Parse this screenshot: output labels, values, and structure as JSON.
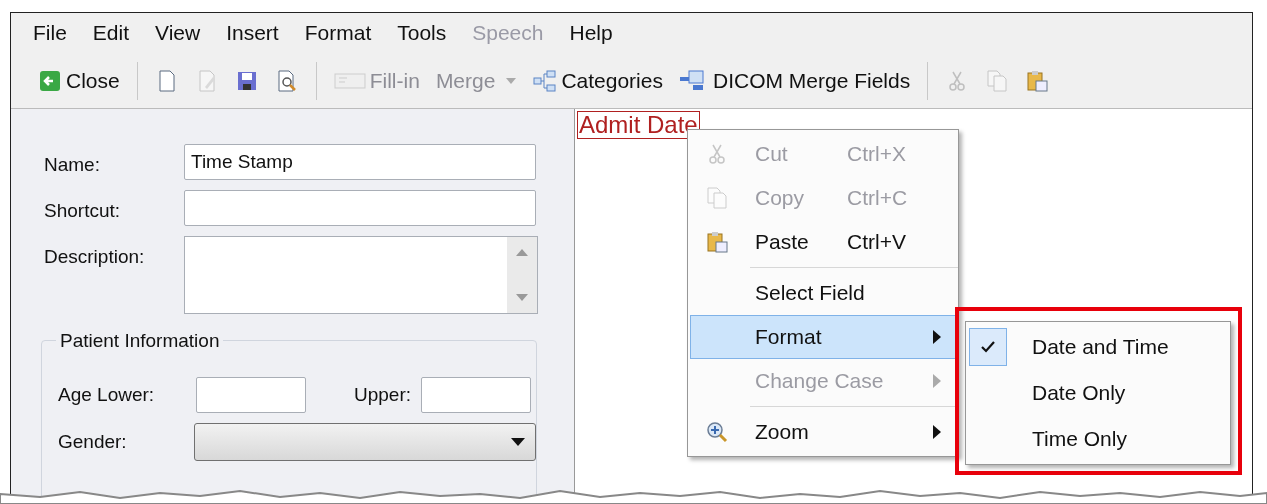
{
  "menu_bar": [
    {
      "label": "File",
      "disabled": false
    },
    {
      "label": "Edit",
      "disabled": false
    },
    {
      "label": "View",
      "disabled": false
    },
    {
      "label": "Insert",
      "disabled": false
    },
    {
      "label": "Format",
      "disabled": false
    },
    {
      "label": "Tools",
      "disabled": false
    },
    {
      "label": "Speech",
      "disabled": true
    },
    {
      "label": "Help",
      "disabled": false
    }
  ],
  "toolbar": [
    {
      "kind": "button",
      "label": "Close",
      "disabled": false
    },
    {
      "kind": "separator"
    },
    {
      "kind": "button",
      "disabled": false
    },
    {
      "kind": "button",
      "disabled": true
    },
    {
      "kind": "button",
      "disabled": false
    },
    {
      "kind": "button",
      "disabled": false
    },
    {
      "kind": "separator"
    },
    {
      "kind": "button",
      "label": "Fill-in",
      "disabled": true
    },
    {
      "kind": "dropdown",
      "label": "Merge",
      "disabled": true
    },
    {
      "kind": "button",
      "label": "Categories",
      "disabled": false
    },
    {
      "kind": "button",
      "label": "DICOM Merge Fields",
      "disabled": false
    },
    {
      "kind": "separator"
    },
    {
      "kind": "button",
      "disabled": true
    },
    {
      "kind": "button",
      "disabled": true
    },
    {
      "kind": "button",
      "disabled": false
    }
  ],
  "form": {
    "name": {
      "label": "Name:",
      "value": "Time Stamp"
    },
    "shortcut": {
      "label": "Shortcut:"
    },
    "description": {
      "label": "Description:"
    },
    "patient_information": {
      "title": "Patient Information",
      "age_lower": {
        "label": "Age Lower:"
      },
      "upper": {
        "label": "Upper:"
      },
      "gender": {
        "label": "Gender:"
      }
    }
  },
  "editor": {
    "field_text": "Admit Date"
  },
  "context_menu": [
    {
      "kind": "command",
      "label": "Cut",
      "shortcut": "Ctrl+X",
      "disabled": true,
      "selected": false,
      "divider_above": false
    },
    {
      "kind": "command",
      "label": "Copy",
      "shortcut": "Ctrl+C",
      "disabled": true,
      "selected": false,
      "divider_above": false
    },
    {
      "kind": "command",
      "label": "Paste",
      "shortcut": "Ctrl+V",
      "disabled": false,
      "selected": false,
      "divider_above": false
    },
    {
      "kind": "command",
      "label": "Select Field",
      "disabled": false,
      "selected": false,
      "divider_above": true
    },
    {
      "kind": "submenu",
      "label": "Format",
      "disabled": false,
      "selected": true,
      "divider_above": false
    },
    {
      "kind": "submenu",
      "label": "Change Case",
      "disabled": true,
      "selected": false,
      "divider_above": false
    },
    {
      "kind": "submenu",
      "label": "Zoom",
      "disabled": false,
      "selected": false,
      "divider_above": true
    }
  ],
  "format_submenu": [
    {
      "label": "Date and Time",
      "checked": true
    },
    {
      "label": "Date Only",
      "checked": false
    },
    {
      "label": "Time Only",
      "checked": false
    }
  ]
}
